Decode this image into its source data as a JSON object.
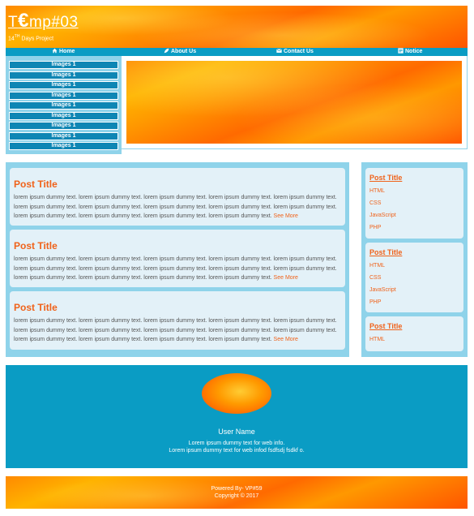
{
  "header": {
    "logo_prefix": "T",
    "logo_euro": "€",
    "logo_suffix": "mp#03",
    "tagline_num": "14",
    "tagline_sup": "TH",
    "tagline_rest": " Days Project"
  },
  "nav": {
    "items": [
      {
        "label": "Home",
        "icon": "home-icon"
      },
      {
        "label": "About Us",
        "icon": "leaf-icon"
      },
      {
        "label": "Contact Us",
        "icon": "envelope-icon"
      },
      {
        "label": "Notice",
        "icon": "notice-icon"
      }
    ]
  },
  "side_menu": {
    "items": [
      "Images 1",
      "Images 1",
      "Images 1",
      "Images 1",
      "Images 1",
      "Images 1",
      "Images 1",
      "Images 1",
      "Images 1",
      "Images 1"
    ]
  },
  "posts": [
    {
      "title": "Post Title",
      "body": "lorem ipsum dummy text. lorem ipsum dummy text. lorem ipsum dummy text. lorem ipsum dummy text. lorem ipsum dummy text. lorem ipsum dummy text. lorem ipsum dummy text. lorem ipsum dummy text. lorem ipsum dummy text. lorem ipsum dummy text. lorem ipsum dummy text. lorem ipsum dummy text. lorem ipsum dummy text. lorem ipsum dummy text.",
      "more": "See More"
    },
    {
      "title": "Post Title",
      "body": "lorem ipsum dummy text. lorem ipsum dummy text. lorem ipsum dummy text. lorem ipsum dummy text. lorem ipsum dummy text. lorem ipsum dummy text. lorem ipsum dummy text. lorem ipsum dummy text. lorem ipsum dummy text. lorem ipsum dummy text. lorem ipsum dummy text. lorem ipsum dummy text. lorem ipsum dummy text. lorem ipsum dummy text.",
      "more": "See More"
    },
    {
      "title": "Post Title",
      "body": "lorem ipsum dummy text. lorem ipsum dummy text. lorem ipsum dummy text. lorem ipsum dummy text. lorem ipsum dummy text. lorem ipsum dummy text. lorem ipsum dummy text. lorem ipsum dummy text. lorem ipsum dummy text. lorem ipsum dummy text. lorem ipsum dummy text. lorem ipsum dummy text. lorem ipsum dummy text. lorem ipsum dummy text.",
      "more": "See More"
    }
  ],
  "sidebar": [
    {
      "title": "Post Title",
      "links": [
        "HTML",
        "CSS",
        "JavaScript",
        "PHP"
      ]
    },
    {
      "title": "Post Title",
      "links": [
        "HTML",
        "CSS",
        "JavaScript",
        "PHP"
      ]
    },
    {
      "title": "Post Title",
      "links": [
        "HTML"
      ]
    }
  ],
  "profile": {
    "username": "User Name",
    "info_line1": "Lorem ipsum dummy text for web info.",
    "info_line2": "Lorem ipsum dummy text for web infod fsdfsdj fsdkf o."
  },
  "footer": {
    "powered": "Powered By- VP#59",
    "copyright": "Copyright © 2017"
  },
  "colors": {
    "accent_orange": "#f0621a",
    "nav_blue": "#0a9cc4",
    "panel_light_blue": "#8fd3ea",
    "card_bg": "#e3f1f8"
  }
}
